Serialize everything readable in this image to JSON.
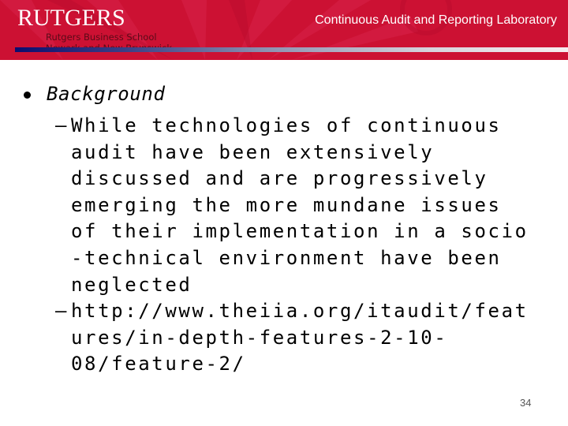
{
  "header": {
    "logo_text": "RUTGERS",
    "school_name": "Rutgers Business School",
    "school_campus": "Newark and New Brunswick",
    "lab_title": "Continuous Audit and Reporting Laboratory",
    "colors": {
      "background": "#cc1133",
      "title_text": "#ffffff",
      "school_text": "#5a0a18"
    }
  },
  "slide": {
    "bullet": {
      "label": "Background",
      "sub_items": [
        {
          "marker": "–",
          "lines": [
            "While technologies of continuous",
            "audit have been extensively",
            "discussed and are progressively",
            "emerging the more mundane issues",
            "of their implementation in a socio",
            "-technical environment have been",
            "neglected"
          ]
        },
        {
          "marker": "–",
          "lines": [
            "http://www.theiia.org/itaudit/feat",
            "ures/in-depth-features-2-10-",
            "08/feature-2/"
          ]
        }
      ]
    },
    "page_number": "34"
  }
}
